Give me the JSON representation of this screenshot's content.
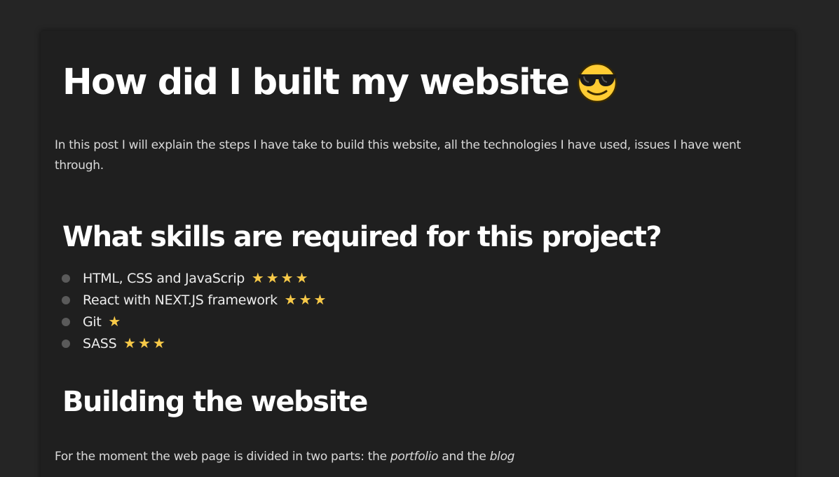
{
  "post": {
    "title": "How did I built my website",
    "title_emoji": "sunglasses-face-emoji",
    "intro": "In this post I will explain the steps I have take to build this website, all the technologies I have used, issues I have went through.",
    "skills_heading": "What skills are required for this project?",
    "skills": [
      {
        "label": "HTML, CSS and JavaScrip",
        "stars": "★★★★",
        "rating": 4
      },
      {
        "label": "React with NEXT.JS framework",
        "stars": "★★★",
        "rating": 3
      },
      {
        "label": "Git",
        "stars": "★",
        "rating": 1
      },
      {
        "label": "SASS",
        "stars": "★★★",
        "rating": 3
      }
    ],
    "building_heading": "Building the website",
    "outro": {
      "before": "For the moment the web page is divided in two parts: the ",
      "portfolio": "portfolio",
      "middle": " and the ",
      "blog": "blog"
    }
  },
  "colors": {
    "page_background": "#252525",
    "card_background": "#1f1f1f",
    "heading": "#ffffff",
    "body_text": "#d9d9d9",
    "star": "#f7c948",
    "bullet": "#5a5a5a"
  }
}
